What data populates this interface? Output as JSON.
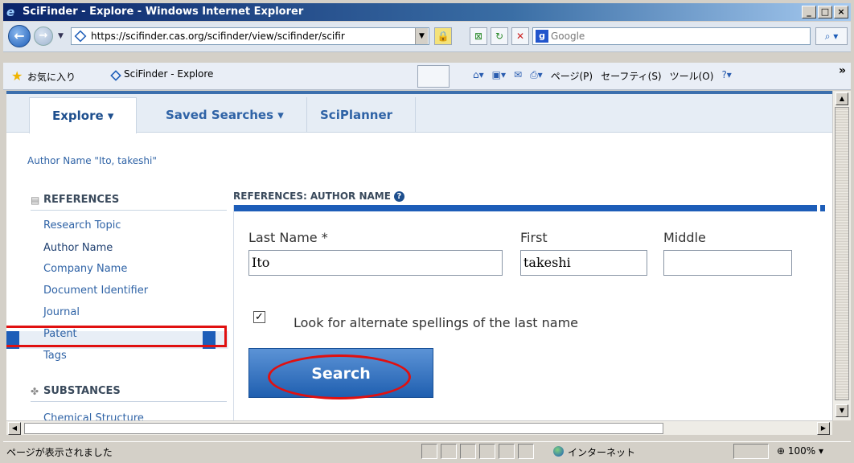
{
  "window": {
    "title": "SciFinder - Explore - Windows Internet Explorer",
    "controls": [
      "_",
      "□",
      "×"
    ]
  },
  "address_bar": {
    "url": "https://scifinder.cas.org/scifinder/view/scifinder/scifir",
    "search_placeholder": "Google"
  },
  "favorites_bar": {
    "favorites_label": "お気に入り",
    "tab_title": "SciFinder - Explore",
    "commands": [
      "ページ(P)",
      "セーフティ(S)",
      "ツール(O)"
    ]
  },
  "app": {
    "tabs": [
      {
        "label": "Explore ▾"
      },
      {
        "label": "Saved Searches ▾"
      },
      {
        "label": "SciPlanner"
      }
    ],
    "breadcrumb": "Author Name \"Ito, takeshi\"",
    "references_heading": "REFERENCES",
    "references_items": [
      "Research Topic",
      "Author Name",
      "Company Name",
      "Document Identifier",
      "Journal",
      "Patent",
      "Tags"
    ],
    "substances_heading": "SUBSTANCES",
    "substances_items": [
      "Chemical Structure"
    ],
    "panel_title": "REFERENCES: AUTHOR NAME",
    "form": {
      "last_name_label": "Last Name *",
      "first_label": "First",
      "middle_label": "Middle",
      "last_name_value": "Ito",
      "first_value": "takeshi",
      "middle_value": "",
      "alt_spellings_label": "Look for alternate spellings of the last name",
      "alt_spellings_checked": true,
      "search_button": "Search"
    }
  },
  "status_bar": {
    "status": "ページが表示されました",
    "zone": "インターネット",
    "zoom": "100%"
  }
}
